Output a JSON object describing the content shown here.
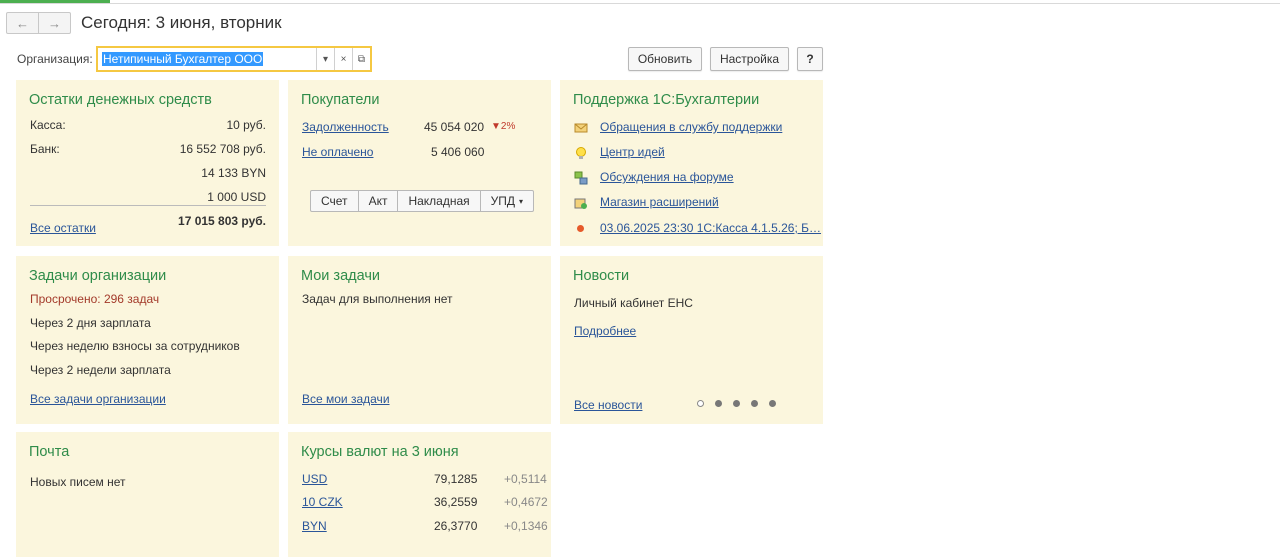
{
  "header": {
    "back_icon": "arrow-left-icon",
    "forward_icon": "arrow-right-icon",
    "title": "Сегодня: 3 июня, вторник"
  },
  "toolbar": {
    "org_label": "Организация:",
    "org_value": "Нетипичный Бухгалтер ООО",
    "refresh_label": "Обновить",
    "settings_label": "Настройка",
    "help_label": "?"
  },
  "cash": {
    "title": "Остатки денежных средств",
    "kassa_label": "Касса:",
    "kassa_value": "10 руб.",
    "bank_label": "Банк:",
    "bank_value_rub": "16 552 708 руб.",
    "bank_value_byn": "14 133 BYN",
    "bank_value_usd": "1 000 USD",
    "total": "17 015 803 руб.",
    "all_link": "Все остатки"
  },
  "buyers": {
    "title": "Покупатели",
    "debt_label": "Задолженность",
    "debt_value": "45 054 020",
    "debt_change": "▼2%",
    "unpaid_label": "Не оплачено",
    "unpaid_value": "5 406 060",
    "buttons": [
      "Счет",
      "Акт",
      "Накладная",
      "УПД"
    ]
  },
  "support": {
    "title": "Поддержка 1С:Бухгалтерии",
    "items": [
      {
        "label": "Обращения в службу поддержки",
        "icon": "envelope-icon"
      },
      {
        "label": "Центр идей",
        "icon": "lightbulb-icon"
      },
      {
        "label": "Обсуждения на форуме",
        "icon": "forum-icon"
      },
      {
        "label": "Магазин расширений",
        "icon": "store-icon"
      },
      {
        "label": "03.06.2025 23:30 1С:Касса 4.1.5.26; Б…",
        "icon": "red-dot-icon"
      }
    ]
  },
  "tasks_org": {
    "title": "Задачи организации",
    "overdue": "Просрочено: 296 задач",
    "items": [
      "Через 2 дня зарплата",
      "Через неделю взносы за сотрудников",
      "Через 2 недели зарплата"
    ],
    "all_link": "Все задачи организации"
  },
  "my_tasks": {
    "title": "Мои задачи",
    "empty": "Задач для выполнения нет",
    "all_link": "Все мои задачи"
  },
  "news": {
    "title": "Новости",
    "headline": "Личный кабинет ЕНС",
    "more_link": "Подробнее",
    "all_link": "Все новости",
    "pages_total": 5,
    "page_current": 1
  },
  "mail": {
    "title": "Почта",
    "empty": "Новых писем нет"
  },
  "rates": {
    "title": "Курсы валют на 3 июня",
    "rows": [
      {
        "code": "USD",
        "rate": "79,1285",
        "change": "+0,5114"
      },
      {
        "code": "10 CZK",
        "rate": "36,2559",
        "change": "+0,4672"
      },
      {
        "code": "BYN",
        "rate": "26,3770",
        "change": "+0,1346"
      }
    ]
  },
  "colors": {
    "panel_bg": "#fbf6dd",
    "title_green": "#2f8c4a",
    "link_blue": "#2a5599",
    "overdue_red": "#a33a2a",
    "focus_yellow": "#f5c842"
  }
}
